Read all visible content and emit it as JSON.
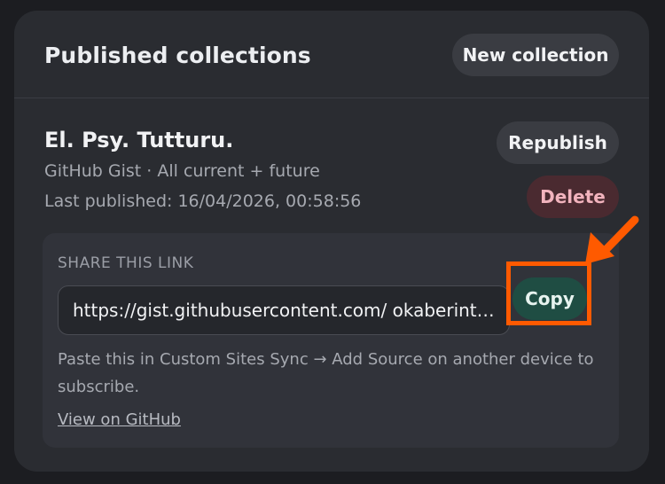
{
  "header": {
    "title": "Published collections",
    "new_collection_label": "New collection"
  },
  "collection": {
    "name": "El. Psy. Tutturu.",
    "source": "GitHub Gist · All current + future",
    "last_published": "Last published: 16/04/2026, 00:58:56",
    "republish_label": "Republish",
    "delete_label": "Delete"
  },
  "share": {
    "label": "SHARE THIS LINK",
    "url": "https://gist.githubusercontent.com/ okaberintar...",
    "copy_label": "Copy",
    "hint": "Paste this in Custom Sites Sync → Add Source on another device to subscribe.",
    "view_link": "View on GitHub"
  },
  "colors": {
    "annotation": "#ff5a00",
    "copy_bg": "#1f4d43",
    "delete_bg": "#4a2a30",
    "delete_text": "#f2b3bd"
  },
  "annotation": {
    "arrow_icon": "arrow-down-left-icon",
    "highlight": "copy-button-highlight"
  }
}
